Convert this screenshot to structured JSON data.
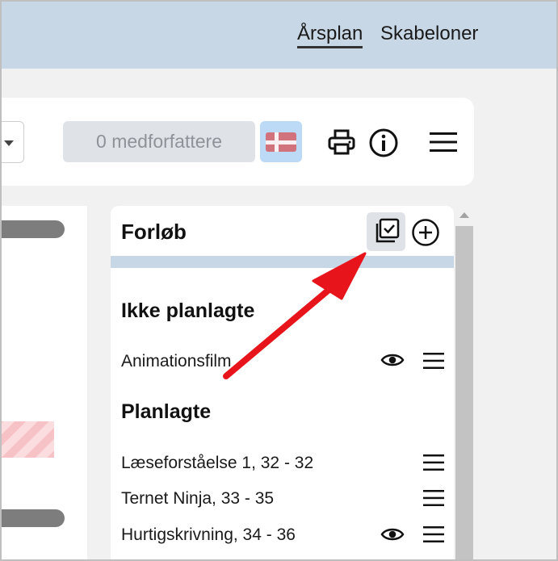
{
  "nav": {
    "items": [
      {
        "label": "Årsplan",
        "active": true
      },
      {
        "label": "Skabeloner",
        "active": false
      }
    ]
  },
  "toolbar": {
    "coauthors_label": "0 medforfattere",
    "language_flag": "denmark-flag-icon",
    "icons": [
      "print-icon",
      "info-icon",
      "menu-icon"
    ]
  },
  "panel": {
    "title": "Forløb",
    "actions": [
      "select-multiple-icon",
      "add-circle-icon"
    ],
    "unplanned": {
      "heading": "Ikke planlagte",
      "items": [
        {
          "label": "Animationsfilm",
          "has_view": true
        }
      ]
    },
    "planned": {
      "heading": "Planlagte",
      "items": [
        {
          "label": "Læseforståelse 1, 32 - 32",
          "has_view": false
        },
        {
          "label": "Ternet Ninja, 33 - 35",
          "has_view": false
        },
        {
          "label": "Hurtigskrivning, 34 - 36",
          "has_view": true
        }
      ]
    }
  },
  "colors": {
    "topbar": "#c8d7e5",
    "panel_bar": "#c8d7e5",
    "flag_button": "#bcdaf5",
    "annotation_arrow": "#e8141b"
  }
}
